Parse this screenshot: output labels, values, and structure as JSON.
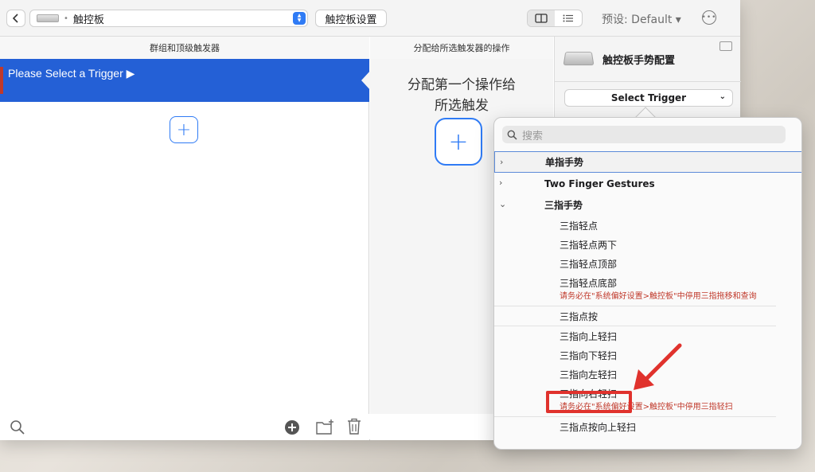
{
  "toolbar": {
    "device_label": "触控板",
    "device_dot": "•",
    "settings_label": "触控板设置",
    "preset_label": "预设: Default ▾"
  },
  "columns": {
    "left_header": "群组和顶级触发器",
    "mid_header": "分配给所选触发器的操作"
  },
  "left_pane": {
    "selected_label": "Please Select a Trigger ▶",
    "add_label": "+"
  },
  "mid_pane": {
    "line1": "分配第一个操作给",
    "line2": "所选触发",
    "add_label": "+"
  },
  "right_pane": {
    "title": "触控板手势配置",
    "trigger_select": "Select Trigger"
  },
  "popup": {
    "search_placeholder": "搜索",
    "categories": [
      {
        "label": "单指手势",
        "expanded": false
      },
      {
        "label": "Two Finger Gestures",
        "expanded": false
      },
      {
        "label": "三指手势",
        "expanded": true
      }
    ],
    "items": [
      {
        "label": "三指轻点"
      },
      {
        "label": "三指轻点两下"
      },
      {
        "label": "三指轻点顶部"
      },
      {
        "label": "三指轻点底部",
        "warning": "请务必在\"系统偏好设置>触控板\"中停用三指拖移和查询"
      },
      {
        "label": "三指点按"
      },
      {
        "label": "三指向上轻扫"
      },
      {
        "label": "三指向下轻扫"
      },
      {
        "label": "三指向左轻扫"
      },
      {
        "label": "三指向右轻扫",
        "warning": "请务必在\"系统偏好设置>触控板\"中停用三指轻扫"
      },
      {
        "label": "三指点按向上轻扫"
      }
    ]
  },
  "colors": {
    "accent": "#2f7bf5",
    "selection": "#2460d6",
    "warning": "#c0392b",
    "annotation": "#e0322d"
  }
}
